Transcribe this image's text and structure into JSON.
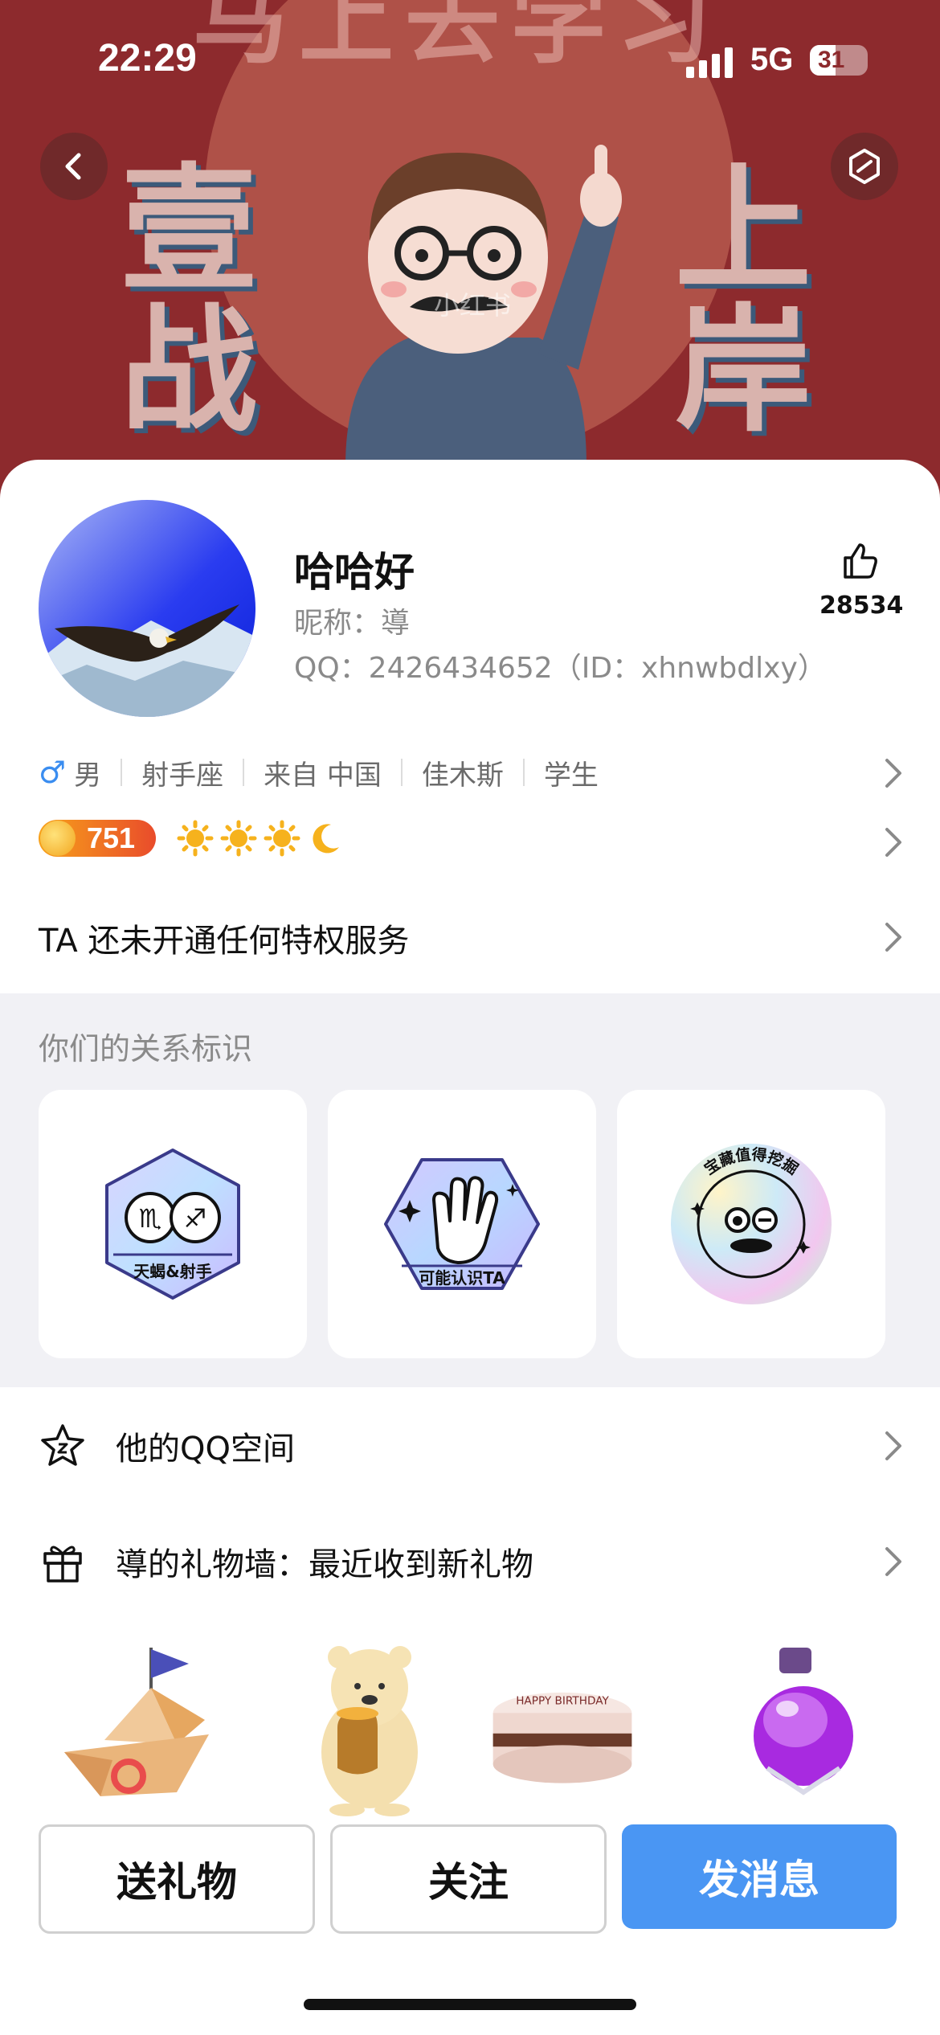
{
  "status_bar": {
    "time": "22:29",
    "network": "5G",
    "battery": "31"
  },
  "cover": {
    "banner": "马上去学习",
    "left_text": "壹战",
    "right_text": "上岸",
    "watermark": "小红书"
  },
  "profile": {
    "name": "哈哈好",
    "nickname": "昵称：導",
    "qq": "QQ：2426434652（ID：xhnwbdlxy）",
    "likes": "28534"
  },
  "tags": {
    "gender_symbol": "♂",
    "gender": "男",
    "zodiac": "射手座",
    "from": "来自 中国",
    "city": "佳木斯",
    "occupation": "学生"
  },
  "level": {
    "value": "751"
  },
  "privilege": "TA 还未开通任何特权服务",
  "relations": {
    "title": "你们的关系标识",
    "items": [
      {
        "label": "天蝎&射手"
      },
      {
        "label": "可能认识TA"
      },
      {
        "label": "宝藏值得挖掘"
      }
    ]
  },
  "links": {
    "qzone": "他的QQ空间",
    "gift_wall": "導的礼物墙：最近收到新礼物"
  },
  "cake_text": "HAPPY BIRTHDAY",
  "actions": {
    "gift": "送礼物",
    "follow": "关注",
    "message": "发消息"
  },
  "colors": {
    "accent": "#4a96f3",
    "cover_bg": "#8d2a2d"
  }
}
